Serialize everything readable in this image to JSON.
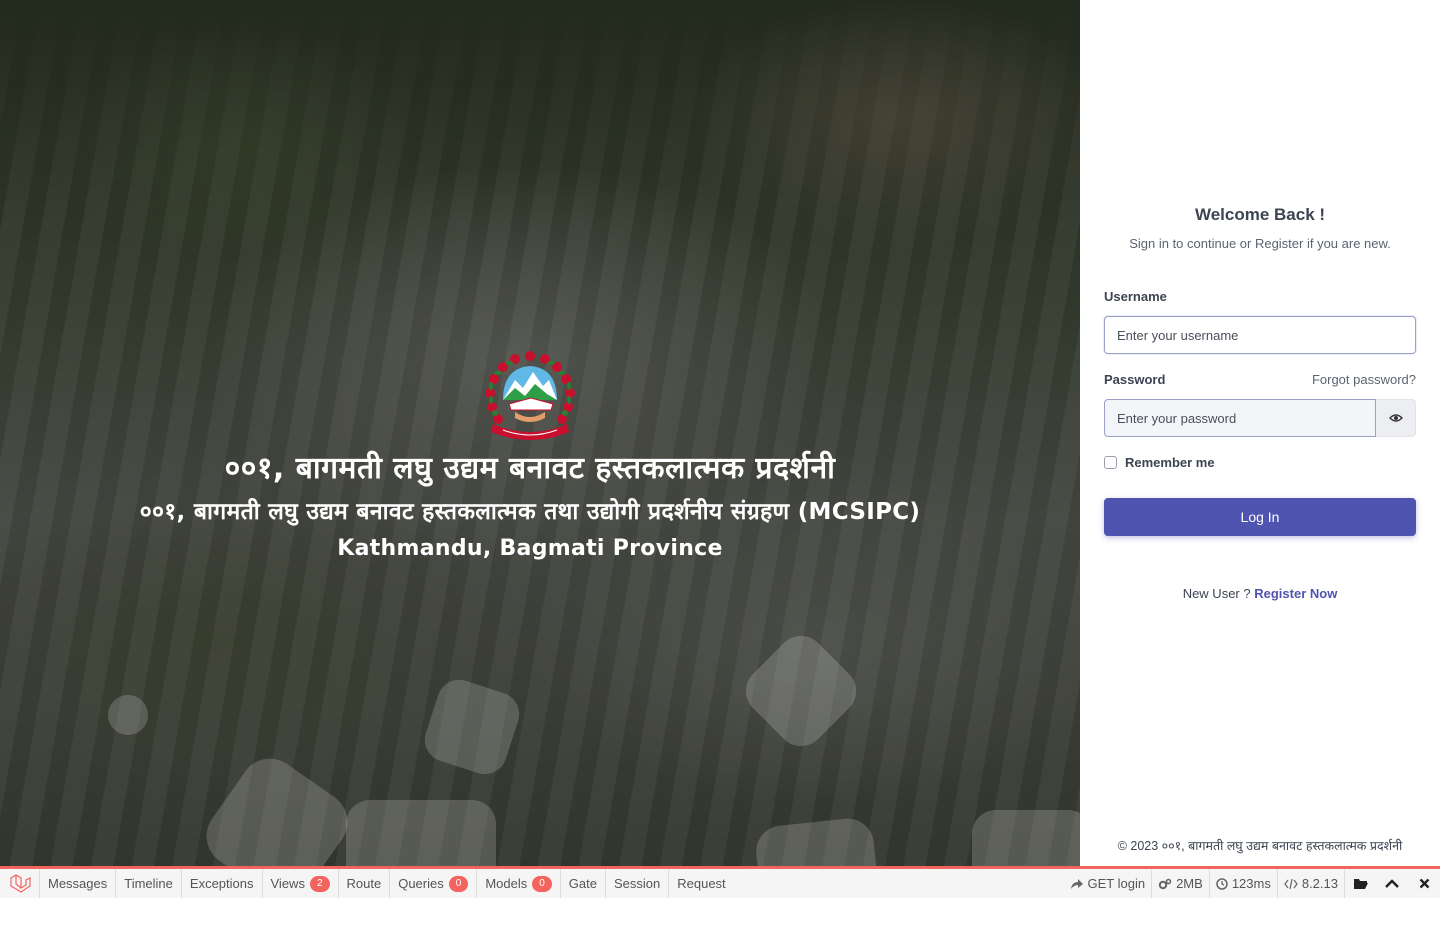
{
  "hero": {
    "title_line1": "००१, बागमती लघु उद्यम बनावट हस्तकलात्मक प्रदर्शनी",
    "title_line2": "००१, बागमती लघु उद्यम बनावट हस्तकलात्मक तथा उद्योगी प्रदर्शनीय संग्रहण (MCSIPC)",
    "location": "Kathmandu, Bagmati Province"
  },
  "login": {
    "welcome": "Welcome Back !",
    "subtitle": "Sign in to continue or Register if you are new.",
    "username_label": "Username",
    "username_placeholder": "Enter your username",
    "password_label": "Password",
    "forgot_password": "Forgot password?",
    "password_placeholder": "Enter your password",
    "remember_me": "Remember me",
    "login_button": "Log In",
    "new_user_text": "New User ?",
    "register_link": "Register Now",
    "copyright": "© 2023 ००१, बागमती लघु उद्यम बनावट हस्तकलात्मक प्रदर्शनी"
  },
  "debugbar": {
    "tabs": [
      {
        "label": "Messages"
      },
      {
        "label": "Timeline"
      },
      {
        "label": "Exceptions"
      },
      {
        "label": "Views",
        "badge": "2"
      },
      {
        "label": "Route"
      },
      {
        "label": "Queries",
        "badge": "0"
      },
      {
        "label": "Models",
        "badge": "0"
      },
      {
        "label": "Gate"
      },
      {
        "label": "Session"
      },
      {
        "label": "Request"
      }
    ],
    "route": "GET login",
    "memory": "2MB",
    "time": "123ms",
    "php_version": "8.2.13"
  },
  "colors": {
    "primary": "#4f54b0",
    "debugbar_accent": "#f4645f",
    "text": "#3d4452"
  }
}
